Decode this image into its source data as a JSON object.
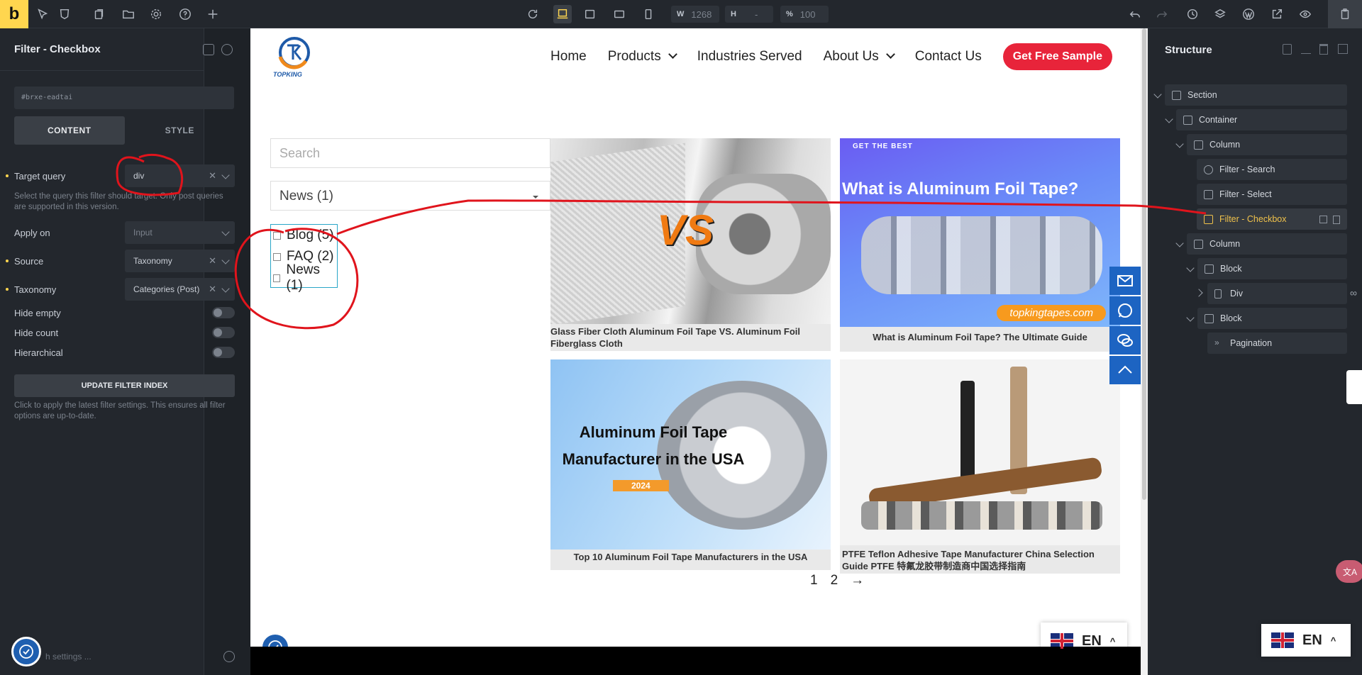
{
  "topbar": {
    "logo": "b",
    "width_label": "W",
    "width_value": "1268",
    "height_label": "H",
    "height_value": "-",
    "zoom_label": "%",
    "zoom_value": "100"
  },
  "left_panel": {
    "title": "Filter - Checkbox",
    "element_id": "#brxe-eadtai",
    "tabs": [
      "CONTENT",
      "STYLE"
    ],
    "target_query": {
      "label": "Target query",
      "value": "div"
    },
    "target_help": "Select the query this filter should target. Only post queries are supported in this version.",
    "apply_on": {
      "label": "Apply on",
      "value": "Input"
    },
    "source": {
      "label": "Source",
      "value": "Taxonomy"
    },
    "taxonomy": {
      "label": "Taxonomy",
      "value": "Categories (Post)"
    },
    "hide_empty": "Hide empty",
    "hide_count": "Hide count",
    "hierarchical": "Hierarchical",
    "update_button": "UPDATE FILTER INDEX",
    "update_help": "Click to apply the latest filter settings. This ensures all filter options are up-to-date.",
    "search_settings": "h settings ..."
  },
  "site": {
    "logo_text": "TOPKING",
    "nav": [
      "Home",
      "Products",
      "Industries Served",
      "About Us",
      "Contact Us"
    ],
    "cta": "Get Free Sample",
    "search_placeholder": "Search",
    "select_value": "News (1)",
    "checkboxes": [
      "Blog (5)",
      "FAQ (2)",
      "News (1)"
    ],
    "cards": [
      {
        "caption": "Glass Fiber Cloth Aluminum Foil Tape VS. Aluminum Foil Fiberglass Cloth",
        "img_text": "VS"
      },
      {
        "caption": "What is Aluminum Foil Tape? The Ultimate Guide",
        "img_text": "What is Aluminum Foil Tape?",
        "img_top": "GET THE BEST",
        "img_badge": "topkingtapes.com"
      },
      {
        "caption": "Top 10 Aluminum Foil Tape Manufacturers in the USA",
        "img_text": "Aluminum Foil Tape Manufacturer in the USA",
        "img_badge": "2024"
      },
      {
        "caption": "PTFE Teflon Adhesive Tape Manufacturer China Selection Guide PTFE 特氟龙胶带制造商中国选择指南"
      }
    ],
    "pagination": [
      "1",
      "2",
      "→"
    ],
    "lang": "EN"
  },
  "structure": {
    "title": "Structure",
    "items": [
      "Section",
      "Container",
      "Column",
      "Filter - Search",
      "Filter - Select",
      "Filter - Checkbox",
      "Column",
      "Block",
      "Div",
      "Block",
      "Pagination"
    ]
  },
  "translate_pill": "文A",
  "colors": {
    "accent": "#ffd64f",
    "cta": "#e8243a",
    "sideButtons": "#1d64c2",
    "annotation": "#e0141c"
  }
}
